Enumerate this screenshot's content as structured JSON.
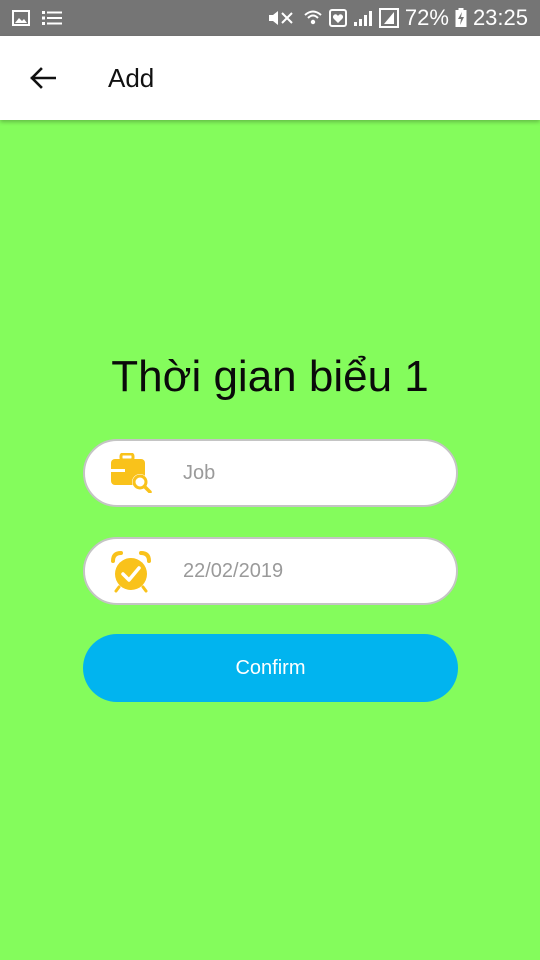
{
  "status_bar": {
    "icons": [
      "image-icon",
      "list-icon",
      "mute-icon",
      "wifi-icon",
      "heart-shield-icon",
      "signal-icon",
      "sim-icon",
      "battery-charging-icon"
    ],
    "battery": "72%",
    "time": "23:25"
  },
  "appbar": {
    "back_icon": "arrow-left-icon",
    "title": "Add"
  },
  "main": {
    "heading": "Thời gian biểu 1",
    "job": {
      "icon": "briefcase-search-icon",
      "placeholder": "Job",
      "value": ""
    },
    "date": {
      "icon": "alarm-clock-check-icon",
      "placeholder": "22/02/2019",
      "value": ""
    },
    "confirm_label": "Confirm"
  },
  "colors": {
    "background": "#84fc5c",
    "status_bar": "#757575",
    "appbar": "#ffffff",
    "confirm_button": "#01b4ef",
    "icon_accent": "#f9c21b"
  }
}
